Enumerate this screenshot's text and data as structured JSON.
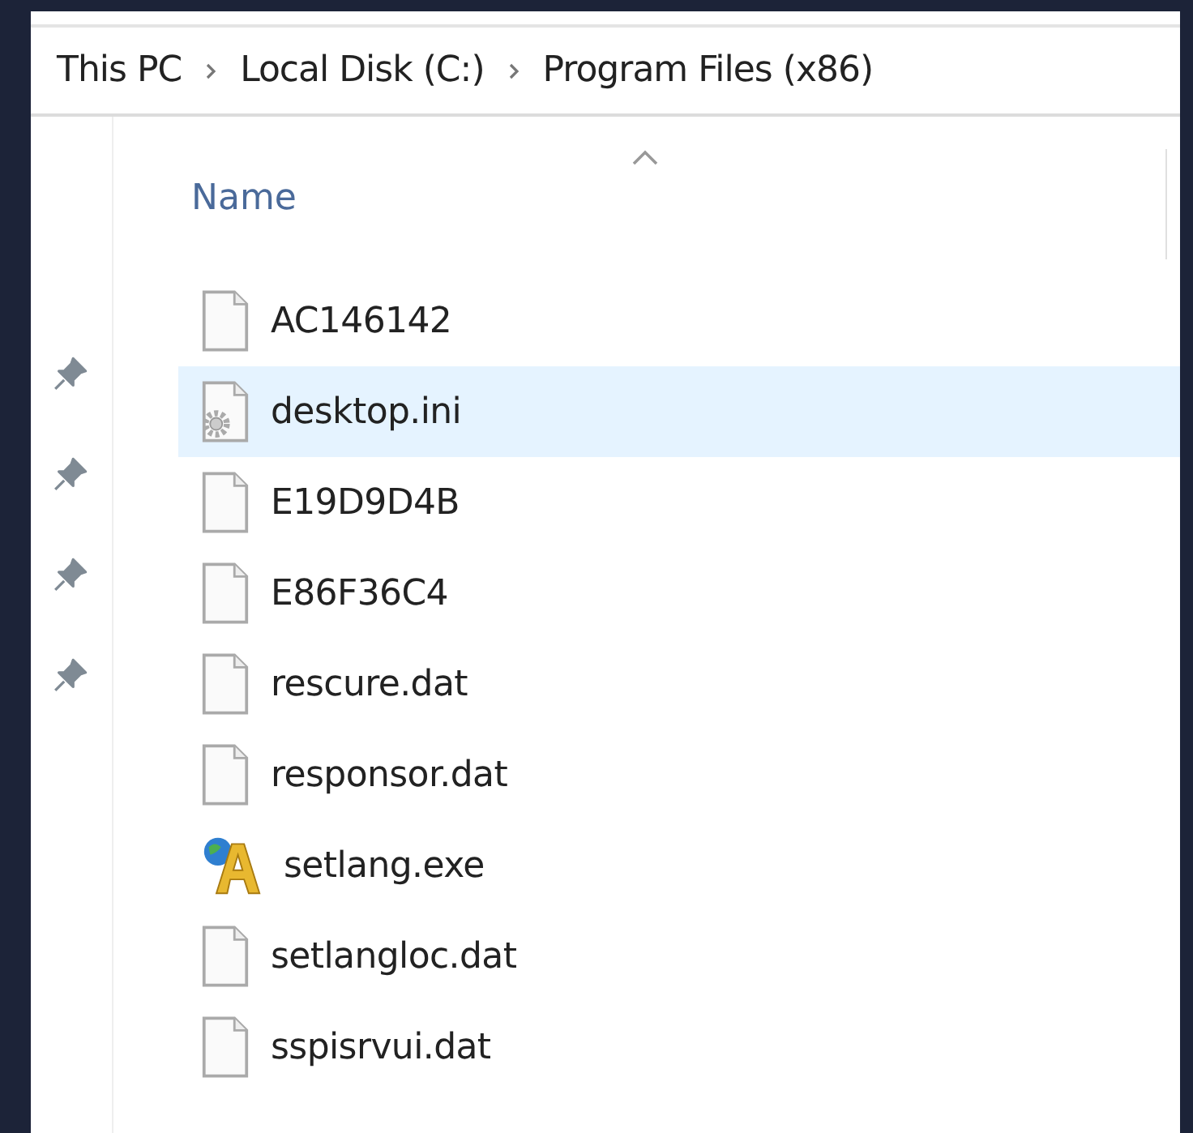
{
  "breadcrumb": [
    "This PC",
    "Local Disk (C:)",
    "Program Files (x86)"
  ],
  "column": {
    "label": "Name",
    "sorted": true
  },
  "files": [
    {
      "name": "AC146142",
      "kind": "generic",
      "selected": false
    },
    {
      "name": "desktop.ini",
      "kind": "settings",
      "selected": true
    },
    {
      "name": "E19D9D4B",
      "kind": "generic",
      "selected": false
    },
    {
      "name": "E86F36C4",
      "kind": "generic",
      "selected": false
    },
    {
      "name": "rescure.dat",
      "kind": "generic",
      "selected": false
    },
    {
      "name": "responsor.dat",
      "kind": "generic",
      "selected": false
    },
    {
      "name": "setlang.exe",
      "kind": "exe",
      "selected": false
    },
    {
      "name": "setlangloc.dat",
      "kind": "generic",
      "selected": false
    },
    {
      "name": "sspisrvui.dat",
      "kind": "generic",
      "selected": false
    }
  ]
}
